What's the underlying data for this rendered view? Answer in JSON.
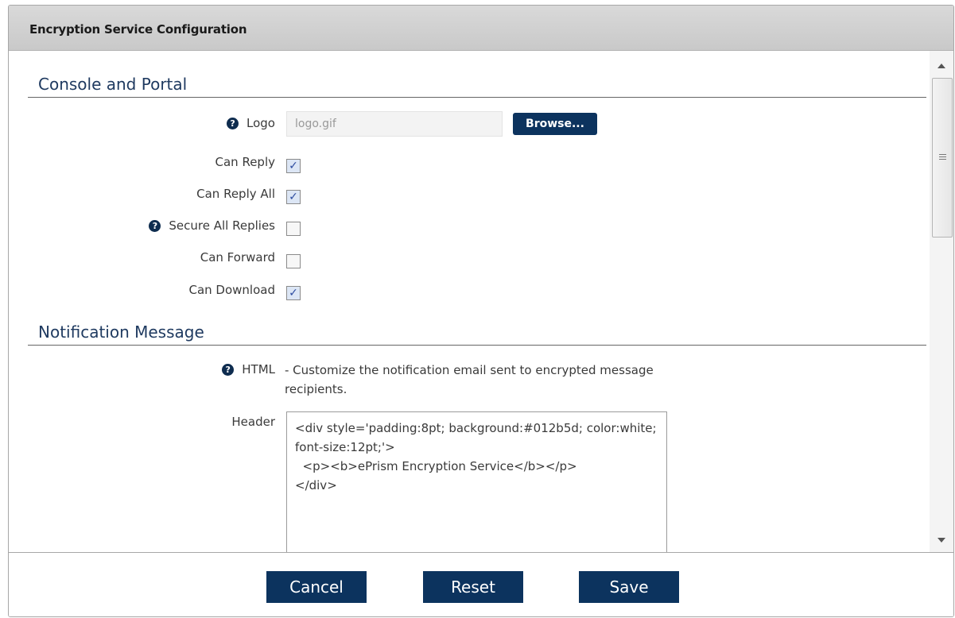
{
  "dialog": {
    "title": "Encryption Service Configuration"
  },
  "console_portal": {
    "title": "Console and Portal",
    "logo": {
      "label": "Logo",
      "value": "logo.gif",
      "browse_label": "Browse..."
    },
    "checkboxes": [
      {
        "label": "Can Reply",
        "checked": true,
        "help": false
      },
      {
        "label": "Can Reply All",
        "checked": true,
        "help": false
      },
      {
        "label": "Secure All Replies",
        "checked": false,
        "help": true
      },
      {
        "label": "Can Forward",
        "checked": false,
        "help": false
      },
      {
        "label": "Can Download",
        "checked": true,
        "help": false
      }
    ]
  },
  "notification": {
    "title": "Notification Message",
    "html_label": "HTML",
    "html_desc": "- Customize the notification email sent to encrypted message recipients.",
    "header_label": "Header",
    "header_value": "<div style='padding:8pt; background:#012b5d; color:white; font-size:12pt;'>\n  <p><b>ePrism Encryption Service</b></p>\n</div>"
  },
  "footer": {
    "cancel": "Cancel",
    "reset": "Reset",
    "save": "Save"
  },
  "colors": {
    "button": "#0c335e",
    "heading": "#1f3a60",
    "title_bar": "#cfcfcf"
  },
  "icons": {
    "help": "question-circle-icon",
    "check": "checkmark-icon"
  }
}
